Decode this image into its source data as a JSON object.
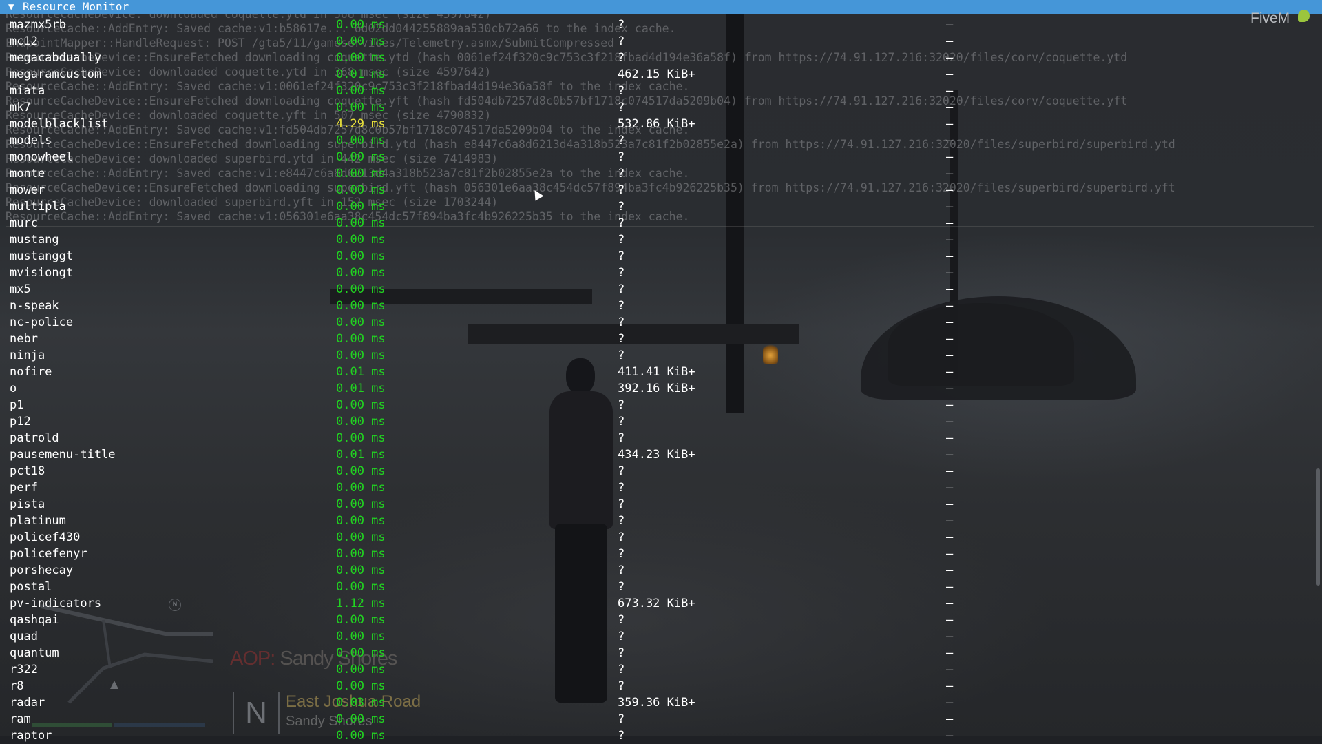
{
  "window": {
    "title": "Resource Monitor",
    "collapse_glyph": "▼"
  },
  "branding": {
    "name": "FiveM"
  },
  "log_lines": [
    "ResourceCacheDevice: downloaded coquette.ytd in 368 msec (size 4597642)",
    "ResourceCache::AddEntry: Saved cache:v1:b58617e... 6d02dd044255889aa530cb72a66 to the index cache.",
    "EndpointMapper::HandleRequest: POST /gta5/11/gameservices/Telemetry.asmx/SubmitCompressed",
    "ResourceCacheDevice::EnsureFetched downloading coquette.ytd (hash 0061ef24f320c9c753c3f218fbad4d194e36a58f) from https://74.91.127.216:32020/files/corv/coquette.ytd",
    "ResourceCacheDevice: downloaded coquette.ytd in 368 msec (size 4597642)",
    "ResourceCache::AddEntry: Saved cache:v1:0061ef24f320c9c753c3f218fbad4d194e36a58f to the index cache.",
    "ResourceCacheDevice::EnsureFetched downloading coquette.yft (hash fd504db7257d8c0b57bf1718c074517da5209b04) from https://74.91.127.216:32020/files/corv/coquette.yft",
    "ResourceCacheDevice: downloaded coquette.yft in 507 msec (size 4790832)",
    "ResourceCache::AddEntry: Saved cache:v1:fd504db7257d8c0b57bf1718c074517da5209b04 to the index cache.",
    "ResourceCacheDevice::EnsureFetched downloading superbird.ytd (hash e8447c6a8d6213d4a318b523a7c81f2b02855e2a) from https://74.91.127.216:32020/files/superbird/superbird.ytd",
    "ResourceCacheDevice: downloaded superbird.ytd in 442 msec (size 7414983)",
    "ResourceCache::AddEntry: Saved cache:v1:e8447c6a8d6213d4a318b523a7c81f2b02855e2a to the index cache.",
    "ResourceCacheDevice::EnsureFetched downloading superbird.yft (hash 056301e6aa38c454dc57f894ba3fc4b926225b35) from https://74.91.127.216:32020/files/superbird/superbird.yft",
    "ResourceCacheDevice: downloaded superbird.yft in 152 msec (size 1703244)",
    "ResourceCache::AddEntry: Saved cache:v1:056301e6aa38c454dc57f894ba3fc4b926225b35 to the index cache."
  ],
  "resources": [
    {
      "name": "mazmx5rb",
      "cpu": "0.00 ms",
      "memory": "?",
      "extra": "–"
    },
    {
      "name": "mc12",
      "cpu": "0.00 ms",
      "memory": "?",
      "extra": "–"
    },
    {
      "name": "megacabdually",
      "cpu": "0.00 ms",
      "memory": "?",
      "extra": "–"
    },
    {
      "name": "megaramcustom",
      "cpu": "0.01 ms",
      "memory": "462.15 KiB+",
      "extra": "–"
    },
    {
      "name": "miata",
      "cpu": "0.00 ms",
      "memory": "?",
      "extra": "–"
    },
    {
      "name": "mk7",
      "cpu": "0.00 ms",
      "memory": "?",
      "extra": "–"
    },
    {
      "name": "modelblacklist",
      "cpu": "4.29 ms",
      "memory": "532.86 KiB+",
      "extra": "–",
      "warn": true
    },
    {
      "name": "models",
      "cpu": "0.00 ms",
      "memory": "?",
      "extra": "–"
    },
    {
      "name": "monowheel",
      "cpu": "0.00 ms",
      "memory": "?",
      "extra": "–"
    },
    {
      "name": "monte",
      "cpu": "0.00 ms",
      "memory": "?",
      "extra": "–"
    },
    {
      "name": "mower",
      "cpu": "0.00 ms",
      "memory": "?",
      "extra": "–"
    },
    {
      "name": "multipla",
      "cpu": "0.00 ms",
      "memory": "?",
      "extra": "–"
    },
    {
      "name": "murc",
      "cpu": "0.00 ms",
      "memory": "?",
      "extra": "–"
    },
    {
      "name": "mustang",
      "cpu": "0.00 ms",
      "memory": "?",
      "extra": "–"
    },
    {
      "name": "mustanggt",
      "cpu": "0.00 ms",
      "memory": "?",
      "extra": "–"
    },
    {
      "name": "mvisiongt",
      "cpu": "0.00 ms",
      "memory": "?",
      "extra": "–"
    },
    {
      "name": "mx5",
      "cpu": "0.00 ms",
      "memory": "?",
      "extra": "–"
    },
    {
      "name": "n-speak",
      "cpu": "0.00 ms",
      "memory": "?",
      "extra": "–"
    },
    {
      "name": "nc-police",
      "cpu": "0.00 ms",
      "memory": "?",
      "extra": "–"
    },
    {
      "name": "nebr",
      "cpu": "0.00 ms",
      "memory": "?",
      "extra": "–"
    },
    {
      "name": "ninja",
      "cpu": "0.00 ms",
      "memory": "?",
      "extra": "–"
    },
    {
      "name": "nofire",
      "cpu": "0.01 ms",
      "memory": "411.41 KiB+",
      "extra": "–"
    },
    {
      "name": "o",
      "cpu": "0.01 ms",
      "memory": "392.16 KiB+",
      "extra": "–"
    },
    {
      "name": "p1",
      "cpu": "0.00 ms",
      "memory": "?",
      "extra": "–"
    },
    {
      "name": "p12",
      "cpu": "0.00 ms",
      "memory": "?",
      "extra": "–"
    },
    {
      "name": "patrold",
      "cpu": "0.00 ms",
      "memory": "?",
      "extra": "–"
    },
    {
      "name": "pausemenu-title",
      "cpu": "0.01 ms",
      "memory": "434.23 KiB+",
      "extra": "–"
    },
    {
      "name": "pct18",
      "cpu": "0.00 ms",
      "memory": "?",
      "extra": "–"
    },
    {
      "name": "perf",
      "cpu": "0.00 ms",
      "memory": "?",
      "extra": "–"
    },
    {
      "name": "pista",
      "cpu": "0.00 ms",
      "memory": "?",
      "extra": "–"
    },
    {
      "name": "platinum",
      "cpu": "0.00 ms",
      "memory": "?",
      "extra": "–"
    },
    {
      "name": "policef430",
      "cpu": "0.00 ms",
      "memory": "?",
      "extra": "–"
    },
    {
      "name": "policefenyr",
      "cpu": "0.00 ms",
      "memory": "?",
      "extra": "–"
    },
    {
      "name": "porshecay",
      "cpu": "0.00 ms",
      "memory": "?",
      "extra": "–"
    },
    {
      "name": "postal",
      "cpu": "0.00 ms",
      "memory": "?",
      "extra": "–"
    },
    {
      "name": "pv-indicators",
      "cpu": "1.12 ms",
      "memory": "673.32 KiB+",
      "extra": "–"
    },
    {
      "name": "qashqai",
      "cpu": "0.00 ms",
      "memory": "?",
      "extra": "–"
    },
    {
      "name": "quad",
      "cpu": "0.00 ms",
      "memory": "?",
      "extra": "–"
    },
    {
      "name": "quantum",
      "cpu": "0.00 ms",
      "memory": "?",
      "extra": "–"
    },
    {
      "name": "r322",
      "cpu": "0.00 ms",
      "memory": "?",
      "extra": "–"
    },
    {
      "name": "r8",
      "cpu": "0.00 ms",
      "memory": "?",
      "extra": "–"
    },
    {
      "name": "radar",
      "cpu": "0.03 ms",
      "memory": "359.36 KiB+",
      "extra": "–"
    },
    {
      "name": "ram",
      "cpu": "0.00 ms",
      "memory": "?",
      "extra": "–"
    },
    {
      "name": "raptor",
      "cpu": "0.00 ms",
      "memory": "?",
      "extra": "–"
    }
  ],
  "hud": {
    "aop_key": "AOP:",
    "aop_value": "Sandy Shores",
    "compass_dir": "N",
    "minimap_north": "N",
    "street": "East Joshua Road",
    "zone": "Sandy Shores"
  },
  "colors": {
    "title_bar": "#4596d8",
    "cpu_ok": "#21d321",
    "cpu_warn": "#ece43b",
    "text": "#ffffff"
  }
}
